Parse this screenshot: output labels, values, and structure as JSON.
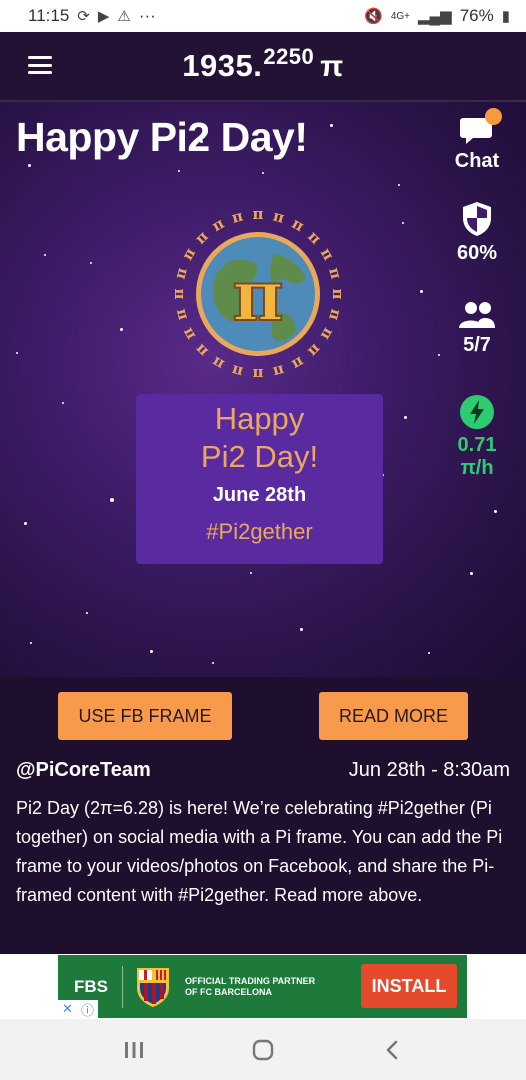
{
  "status_bar": {
    "time": "11:15",
    "dots": "···",
    "network": "4G+",
    "battery": "76%"
  },
  "header": {
    "balance_main": "1935.",
    "balance_decimals": "2250",
    "currency_symbol": "π"
  },
  "hero": {
    "title": "Happy Pi2 Day!",
    "card": {
      "line1": "Happy",
      "line2": "Pi2 Day!",
      "date": "June 28th",
      "hashtag": "#Pi2gether"
    }
  },
  "rail": {
    "chat_label": "Chat",
    "security_value": "60%",
    "team_value": "5/7",
    "rate_value": "0.71",
    "rate_unit": "π/h"
  },
  "post": {
    "fb_button": "USE FB FRAME",
    "more_button": "READ MORE",
    "author": "@PiCoreTeam",
    "timestamp": "Jun 28th - 8:30am",
    "body": "Pi2 Day (2π=6.28) is here! We’re celebrating #Pi2gether (Pi together) on social media with a Pi frame. You can add the Pi frame to your videos/photos on Facebook, and share the Pi-framed content with #Pi2gether. Read more above."
  },
  "ad": {
    "brand": "FBS",
    "tagline": "OFFICIAL TRADING PARTNER OF FC BARCELONA",
    "install": "INSTALL",
    "close": "✕",
    "info": "ⓘ"
  },
  "colors": {
    "accent_orange": "#f79a4b",
    "card_purple": "#5a2ba0",
    "rate_green": "#2ecc71",
    "gold": "#e9a85a"
  },
  "icons": [
    "menu-icon",
    "chat-icon",
    "shield-icon",
    "team-icon",
    "lightning-icon",
    "recents-icon",
    "home-icon",
    "back-icon"
  ]
}
